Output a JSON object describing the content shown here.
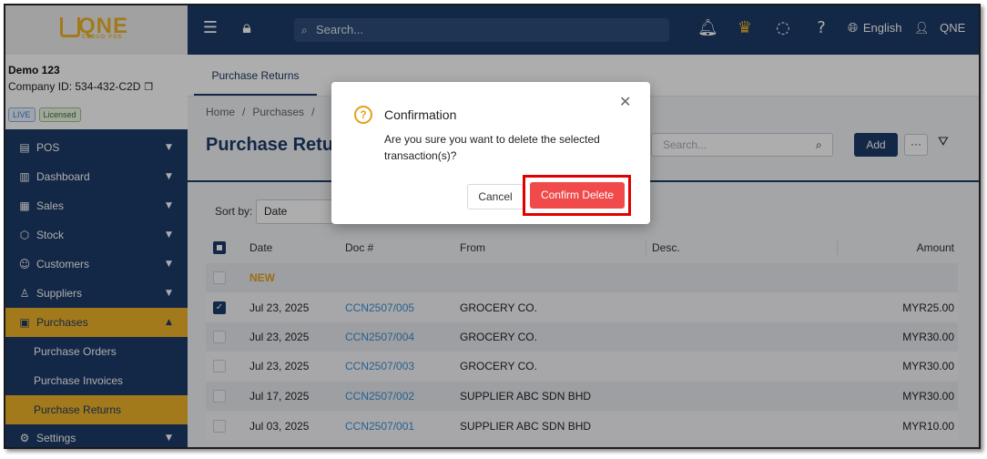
{
  "app": {
    "logo_text": "QNE",
    "logo_sub": "CLOUD POS"
  },
  "topbar": {
    "search_placeholder": "Search...",
    "language": "English",
    "user": "QNE"
  },
  "company": {
    "name": "Demo 123",
    "id_text": "Company ID: 534-432-C2D",
    "badges": [
      "LIVE",
      "Licensed"
    ]
  },
  "sidebar": {
    "items": [
      {
        "label": "POS",
        "icon": "register-icon"
      },
      {
        "label": "Dashboard",
        "icon": "chart-icon"
      },
      {
        "label": "Sales",
        "icon": "cart-icon"
      },
      {
        "label": "Stock",
        "icon": "box-icon"
      },
      {
        "label": "Customers",
        "icon": "people-icon"
      },
      {
        "label": "Suppliers",
        "icon": "person-icon"
      },
      {
        "label": "Purchases",
        "icon": "purchase-icon"
      }
    ],
    "sub_items": [
      "Purchase Orders",
      "Purchase Invoices",
      "Purchase Returns"
    ],
    "settings": "Settings"
  },
  "main": {
    "tab": "Purchase Returns",
    "breadcrumb": [
      "Home",
      "/",
      "Purchases",
      "/"
    ],
    "title": "Purchase Retu",
    "search_placeholder": "Search...",
    "add_label": "Add",
    "more_label": "···",
    "sort_label": "Sort by:",
    "sort_value": "Date"
  },
  "table": {
    "columns": [
      "Date",
      "Doc #",
      "From",
      "Desc.",
      "Amount"
    ],
    "group_label": "NEW",
    "rows": [
      {
        "date": "Jul 23, 2025",
        "doc": "CCN2507/005",
        "from": "GROCERY CO.",
        "desc": "",
        "amount": "MYR25.00",
        "checked": true
      },
      {
        "date": "Jul 23, 2025",
        "doc": "CCN2507/004",
        "from": "GROCERY CO.",
        "desc": "",
        "amount": "MYR30.00",
        "checked": false
      },
      {
        "date": "Jul 23, 2025",
        "doc": "CCN2507/003",
        "from": "GROCERY CO.",
        "desc": "",
        "amount": "MYR30.00",
        "checked": false
      },
      {
        "date": "Jul 17, 2025",
        "doc": "CCN2507/002",
        "from": "SUPPLIER ABC SDN BHD",
        "desc": "",
        "amount": "MYR30.00",
        "checked": false
      },
      {
        "date": "Jul 03, 2025",
        "doc": "CCN2507/001",
        "from": "SUPPLIER ABC SDN BHD",
        "desc": "",
        "amount": "MYR10.00",
        "checked": false
      }
    ]
  },
  "dialog": {
    "title": "Confirmation",
    "message": "Are you sure you want to delete the selected transaction(s)?",
    "cancel": "Cancel",
    "confirm": "Confirm Delete"
  },
  "colors": {
    "primary": "#1c3a68",
    "accent": "#f0b429",
    "danger": "#f04a4a",
    "link": "#3a8fd3"
  }
}
